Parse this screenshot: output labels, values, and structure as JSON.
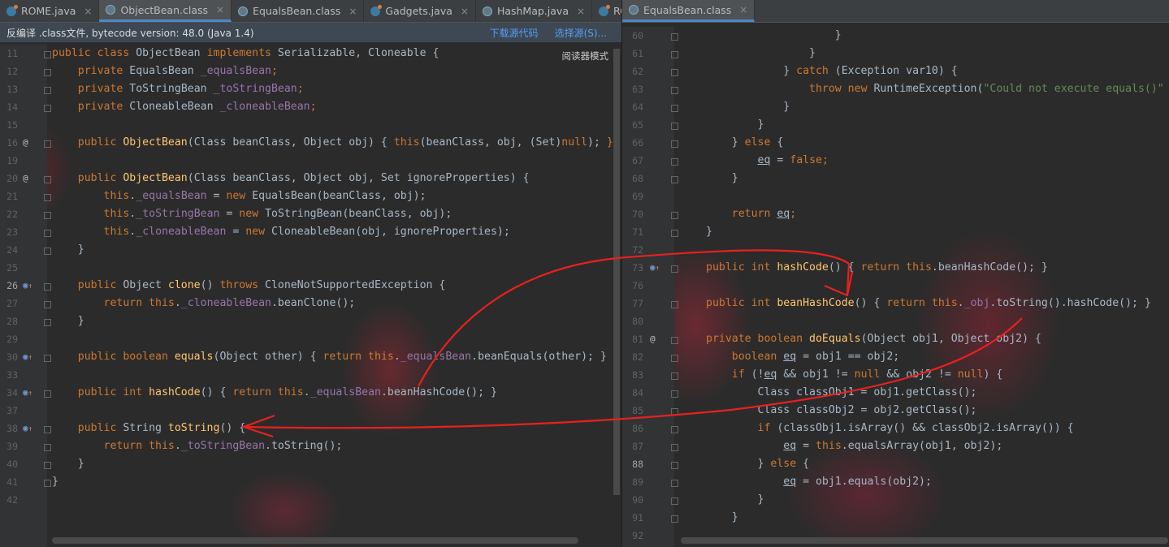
{
  "left_tabs": [
    {
      "label": "ROME.java",
      "icon": "java-file-icon",
      "active": false
    },
    {
      "label": "ObjectBean.class",
      "icon": "class-file-icon",
      "active": true
    },
    {
      "label": "EqualsBean.class",
      "icon": "class-file-icon",
      "active": false
    },
    {
      "label": "Gadgets.java",
      "icon": "java-file-icon",
      "active": false
    },
    {
      "label": "HashMap.java",
      "icon": "class-file-icon",
      "active": false
    },
    {
      "label": "RC",
      "icon": "java-file-icon",
      "active": false
    }
  ],
  "right_tabs": [
    {
      "label": "EqualsBean.class",
      "icon": "class-file-icon",
      "active": true
    }
  ],
  "tab_overflow_icon": "chevron-down-icon",
  "tab_settings_icon": "gear-icon",
  "close_glyph": "×",
  "infobar": {
    "message": "反编译 .class文件, bytecode version: 48.0 (Java 1.4)",
    "download_link": "下载源代码",
    "choose_link": "选择源(S)..."
  },
  "reader_mode": "阅读器模式",
  "colors": {
    "keyword": "#cc7832",
    "method": "#ffc66d",
    "field": "#9876aa",
    "string": "#6a8759",
    "text": "#a9b7c6",
    "annotation_red": "#e8211f"
  },
  "left_lines": [
    {
      "n": "11",
      "marker": "",
      "code": [
        [
          "kw",
          "public class "
        ],
        [
          "t",
          "ObjectBean "
        ],
        [
          "kw",
          "implements "
        ],
        [
          "t",
          "Serializable, Cloneable {"
        ]
      ]
    },
    {
      "n": "12",
      "marker": "",
      "code": [
        [
          "t",
          "    "
        ],
        [
          "kw",
          "private "
        ],
        [
          "t",
          "EqualsBean "
        ],
        [
          "fld",
          "_equalsBean"
        ],
        [
          "kw",
          ";"
        ]
      ]
    },
    {
      "n": "13",
      "marker": "",
      "code": [
        [
          "t",
          "    "
        ],
        [
          "kw",
          "private "
        ],
        [
          "t",
          "ToStringBean "
        ],
        [
          "fld",
          "_toStringBean"
        ],
        [
          "kw",
          ";"
        ]
      ]
    },
    {
      "n": "14",
      "marker": "",
      "code": [
        [
          "t",
          "    "
        ],
        [
          "kw",
          "private "
        ],
        [
          "t",
          "CloneableBean "
        ],
        [
          "fld",
          "_cloneableBean"
        ],
        [
          "kw",
          ";"
        ]
      ]
    },
    {
      "n": "15",
      "marker": "",
      "code": []
    },
    {
      "n": "16",
      "marker": "@",
      "code": [
        [
          "t",
          "    "
        ],
        [
          "kw",
          "public "
        ],
        [
          "fn",
          "ObjectBean"
        ],
        [
          "t",
          "(Class beanClass, Object obj) { "
        ],
        [
          "kw",
          "this"
        ],
        [
          "t",
          "(beanClass, obj, (Set)"
        ],
        [
          "kw",
          "null"
        ],
        [
          "t",
          ");"
        ],
        [
          "kw",
          " }"
        ]
      ]
    },
    {
      "n": "19",
      "marker": "",
      "code": []
    },
    {
      "n": "20",
      "marker": "@",
      "code": [
        [
          "t",
          "    "
        ],
        [
          "kw",
          "public "
        ],
        [
          "fn",
          "ObjectBean"
        ],
        [
          "t",
          "(Class beanClass, Object obj, Set ignoreProperties) {"
        ]
      ]
    },
    {
      "n": "21",
      "marker": "",
      "code": [
        [
          "t",
          "        "
        ],
        [
          "kw",
          "this"
        ],
        [
          "t",
          "."
        ],
        [
          "fld",
          "_equalsBean"
        ],
        [
          "t",
          " = "
        ],
        [
          "kw",
          "new "
        ],
        [
          "t",
          "EqualsBean(beanClass, obj);"
        ]
      ]
    },
    {
      "n": "22",
      "marker": "",
      "code": [
        [
          "t",
          "        "
        ],
        [
          "kw",
          "this"
        ],
        [
          "t",
          "."
        ],
        [
          "fld",
          "_toStringBean"
        ],
        [
          "t",
          " = "
        ],
        [
          "kw",
          "new "
        ],
        [
          "t",
          "ToStringBean(beanClass, obj);"
        ]
      ]
    },
    {
      "n": "23",
      "marker": "",
      "code": [
        [
          "t",
          "        "
        ],
        [
          "kw",
          "this"
        ],
        [
          "t",
          "."
        ],
        [
          "fld",
          "_cloneableBean"
        ],
        [
          "t",
          " = "
        ],
        [
          "kw",
          "new "
        ],
        [
          "t",
          "CloneableBean(obj, ignoreProperties);"
        ]
      ]
    },
    {
      "n": "24",
      "marker": "",
      "code": [
        [
          "t",
          "    }"
        ]
      ]
    },
    {
      "n": "25",
      "marker": "",
      "code": []
    },
    {
      "n": "26",
      "marker": "o↑",
      "code": [
        [
          "t",
          "    "
        ],
        [
          "kw",
          "public "
        ],
        [
          "t",
          "Object "
        ],
        [
          "fn",
          "clone"
        ],
        [
          "t",
          "() "
        ],
        [
          "kw",
          "throws "
        ],
        [
          "t",
          "CloneNotSupportedException {"
        ]
      ]
    },
    {
      "n": "27",
      "marker": "",
      "code": [
        [
          "t",
          "        "
        ],
        [
          "kw",
          "return this"
        ],
        [
          "t",
          "."
        ],
        [
          "fld",
          "_cloneableBean"
        ],
        [
          "t",
          ".beanClone();"
        ]
      ]
    },
    {
      "n": "28",
      "marker": "",
      "code": [
        [
          "t",
          "    }"
        ]
      ]
    },
    {
      "n": "29",
      "marker": "",
      "code": []
    },
    {
      "n": "30",
      "marker": "o↑",
      "code": [
        [
          "t",
          "    "
        ],
        [
          "kw",
          "public boolean "
        ],
        [
          "fn",
          "equals"
        ],
        [
          "t",
          "(Object other) { "
        ],
        [
          "kw",
          "return this"
        ],
        [
          "t",
          "."
        ],
        [
          "fld",
          "_equalsBean"
        ],
        [
          "t",
          ".beanEquals(other); }"
        ]
      ]
    },
    {
      "n": "33",
      "marker": "",
      "code": []
    },
    {
      "n": "34",
      "marker": "o↑",
      "code": [
        [
          "t",
          "    "
        ],
        [
          "kw",
          "public int "
        ],
        [
          "fn",
          "hashCode"
        ],
        [
          "t",
          "() { "
        ],
        [
          "kw",
          "return this"
        ],
        [
          "t",
          "."
        ],
        [
          "fld",
          "_equalsBean"
        ],
        [
          "t",
          ".beanHashCode(); }"
        ]
      ]
    },
    {
      "n": "37",
      "marker": "",
      "code": []
    },
    {
      "n": "38",
      "marker": "o↑",
      "code": [
        [
          "t",
          "    "
        ],
        [
          "kw",
          "public "
        ],
        [
          "t",
          "String "
        ],
        [
          "fn",
          "toString"
        ],
        [
          "t",
          "() {"
        ]
      ]
    },
    {
      "n": "39",
      "marker": "",
      "code": [
        [
          "t",
          "        "
        ],
        [
          "kw",
          "return this"
        ],
        [
          "t",
          "."
        ],
        [
          "fld",
          "_toStringBean"
        ],
        [
          "t",
          ".toString();"
        ]
      ]
    },
    {
      "n": "40",
      "marker": "",
      "code": [
        [
          "t",
          "    }"
        ]
      ]
    },
    {
      "n": "41",
      "marker": "",
      "code": [
        [
          "t",
          "}"
        ]
      ]
    },
    {
      "n": "42",
      "marker": "",
      "code": []
    }
  ],
  "right_lines": [
    {
      "n": "60",
      "marker": "",
      "code": [
        [
          "t",
          "                    }"
        ]
      ]
    },
    {
      "n": "61",
      "marker": "",
      "code": [
        [
          "t",
          "                }"
        ]
      ]
    },
    {
      "n": "62",
      "marker": "",
      "code": [
        [
          "t",
          "            } "
        ],
        [
          "kw",
          "catch "
        ],
        [
          "t",
          "(Exception var10) {"
        ]
      ]
    },
    {
      "n": "63",
      "marker": "",
      "code": [
        [
          "t",
          "                "
        ],
        [
          "kw",
          "throw new "
        ],
        [
          "t",
          "RuntimeException("
        ],
        [
          "str",
          "\"Could not execute equals()\""
        ]
      ]
    },
    {
      "n": "64",
      "marker": "",
      "code": [
        [
          "t",
          "            }"
        ]
      ]
    },
    {
      "n": "65",
      "marker": "",
      "code": [
        [
          "t",
          "        }"
        ]
      ]
    },
    {
      "n": "66",
      "marker": "",
      "code": [
        [
          "t",
          "    } "
        ],
        [
          "kw",
          "else "
        ],
        [
          "t",
          "{"
        ]
      ]
    },
    {
      "n": "67",
      "marker": "",
      "code": [
        [
          "t",
          "        "
        ],
        [
          "ul",
          "eq"
        ],
        [
          "t",
          " = "
        ],
        [
          "kw",
          "false;"
        ]
      ]
    },
    {
      "n": "68",
      "marker": "",
      "code": [
        [
          "t",
          "    }"
        ]
      ]
    },
    {
      "n": "69",
      "marker": "",
      "code": []
    },
    {
      "n": "70",
      "marker": "",
      "code": [
        [
          "t",
          "    "
        ],
        [
          "kw",
          "return "
        ],
        [
          "ul",
          "eq"
        ],
        [
          "kw",
          ";"
        ]
      ]
    },
    {
      "n": "71",
      "marker": "",
      "code": [
        [
          "t",
          "}"
        ]
      ]
    },
    {
      "n": "72",
      "marker": "",
      "code": []
    },
    {
      "n": "73",
      "marker": "o↑",
      "code": [
        [
          "kw",
          "public int "
        ],
        [
          "fn",
          "hashCode"
        ],
        [
          "t",
          "() { "
        ],
        [
          "kw",
          "return this"
        ],
        [
          "t",
          ".beanHashCode(); }"
        ]
      ]
    },
    {
      "n": "76",
      "marker": "",
      "code": []
    },
    {
      "n": "77",
      "marker": "",
      "code": [
        [
          "kw",
          "public int "
        ],
        [
          "fn",
          "beanHashCode"
        ],
        [
          "t",
          "() { "
        ],
        [
          "kw",
          "return this"
        ],
        [
          "t",
          "."
        ],
        [
          "fld",
          "_obj"
        ],
        [
          "t",
          ".toString().hashCode(); }"
        ]
      ]
    },
    {
      "n": "80",
      "marker": "",
      "code": []
    },
    {
      "n": "81",
      "marker": "@",
      "code": [
        [
          "kw",
          "private boolean "
        ],
        [
          "fn",
          "doEquals"
        ],
        [
          "t",
          "(Object obj1, Object obj2) {"
        ]
      ]
    },
    {
      "n": "82",
      "marker": "",
      "code": [
        [
          "t",
          "    "
        ],
        [
          "kw",
          "boolean "
        ],
        [
          "ul",
          "eq"
        ],
        [
          "t",
          " = obj1 == obj2;"
        ]
      ]
    },
    {
      "n": "83",
      "marker": "",
      "code": [
        [
          "t",
          "    "
        ],
        [
          "kw",
          "if "
        ],
        [
          "t",
          "(!"
        ],
        [
          "ul",
          "eq"
        ],
        [
          "t",
          " && obj1 != "
        ],
        [
          "kw",
          "null "
        ],
        [
          "t",
          "&& obj2 != "
        ],
        [
          "kw",
          "null"
        ],
        [
          "t",
          ") {"
        ]
      ]
    },
    {
      "n": "84",
      "marker": "",
      "code": [
        [
          "t",
          "        Class classObj1 = obj1.getClass();"
        ]
      ]
    },
    {
      "n": "85",
      "marker": "",
      "code": [
        [
          "t",
          "        Class classObj2 = obj2.getClass();"
        ]
      ]
    },
    {
      "n": "86",
      "marker": "",
      "code": [
        [
          "t",
          "        "
        ],
        [
          "kw",
          "if "
        ],
        [
          "t",
          "(classObj1.isArray() && classObj2.isArray()) {"
        ]
      ]
    },
    {
      "n": "87",
      "marker": "",
      "code": [
        [
          "t",
          "            "
        ],
        [
          "ul",
          "eq"
        ],
        [
          "t",
          " = "
        ],
        [
          "kw",
          "this"
        ],
        [
          "t",
          ".equalsArray(obj1, obj2);"
        ]
      ]
    },
    {
      "n": "88",
      "marker": "",
      "code": [
        [
          "t",
          "        } "
        ],
        [
          "kw",
          "else "
        ],
        [
          "t",
          "{"
        ]
      ]
    },
    {
      "n": "89",
      "marker": "",
      "code": [
        [
          "t",
          "            "
        ],
        [
          "ul",
          "eq"
        ],
        [
          "t",
          " = obj1.equals(obj2);"
        ]
      ]
    },
    {
      "n": "90",
      "marker": "",
      "code": [
        [
          "t",
          "        }"
        ]
      ]
    },
    {
      "n": "91",
      "marker": "",
      "code": [
        [
          "t",
          "    }"
        ]
      ]
    },
    {
      "n": "92",
      "marker": "",
      "code": []
    }
  ]
}
